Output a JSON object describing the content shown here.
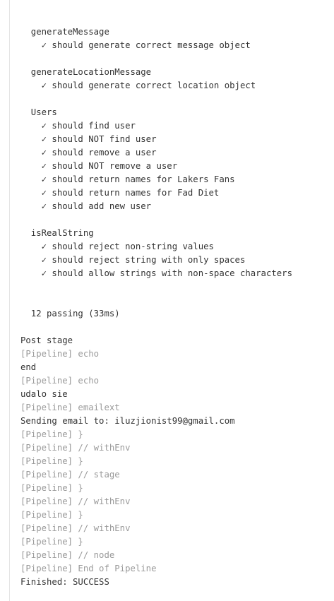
{
  "test_output": [
    {
      "kind": "blank",
      "text": ""
    },
    {
      "kind": "suite",
      "text": "  generateMessage"
    },
    {
      "kind": "test",
      "text": "    ✓ should generate correct message object"
    },
    {
      "kind": "blank",
      "text": ""
    },
    {
      "kind": "suite",
      "text": "  generateLocationMessage"
    },
    {
      "kind": "test",
      "text": "    ✓ should generate correct location object"
    },
    {
      "kind": "blank",
      "text": ""
    },
    {
      "kind": "suite",
      "text": "  Users"
    },
    {
      "kind": "test",
      "text": "    ✓ should find user"
    },
    {
      "kind": "test",
      "text": "    ✓ should NOT find user"
    },
    {
      "kind": "test",
      "text": "    ✓ should remove a user"
    },
    {
      "kind": "test",
      "text": "    ✓ should NOT remove a user"
    },
    {
      "kind": "test",
      "text": "    ✓ should return names for Lakers Fans"
    },
    {
      "kind": "test",
      "text": "    ✓ should return names for Fad Diet"
    },
    {
      "kind": "test",
      "text": "    ✓ should add new user"
    },
    {
      "kind": "blank",
      "text": ""
    },
    {
      "kind": "suite",
      "text": "  isRealString"
    },
    {
      "kind": "test",
      "text": "    ✓ should reject non-string values"
    },
    {
      "kind": "test",
      "text": "    ✓ should reject string with only spaces"
    },
    {
      "kind": "test",
      "text": "    ✓ should allow strings with non-space characters"
    },
    {
      "kind": "blank",
      "text": ""
    },
    {
      "kind": "blank",
      "text": ""
    },
    {
      "kind": "summary",
      "text": "  12 passing (33ms)"
    },
    {
      "kind": "blank",
      "text": ""
    }
  ],
  "pipeline_output": [
    {
      "kind": "normal",
      "text": "Post stage"
    },
    {
      "kind": "pipeline",
      "text": "[Pipeline] echo"
    },
    {
      "kind": "normal",
      "text": "end"
    },
    {
      "kind": "pipeline",
      "text": "[Pipeline] echo"
    },
    {
      "kind": "normal",
      "text": "udalo sie"
    },
    {
      "kind": "pipeline",
      "text": "[Pipeline] emailext"
    },
    {
      "kind": "normal",
      "text": "Sending email to: iluzjionist99@gmail.com"
    },
    {
      "kind": "pipeline",
      "text": "[Pipeline] }"
    },
    {
      "kind": "pipeline",
      "text": "[Pipeline] // withEnv"
    },
    {
      "kind": "pipeline",
      "text": "[Pipeline] }"
    },
    {
      "kind": "pipeline",
      "text": "[Pipeline] // stage"
    },
    {
      "kind": "pipeline",
      "text": "[Pipeline] }"
    },
    {
      "kind": "pipeline",
      "text": "[Pipeline] // withEnv"
    },
    {
      "kind": "pipeline",
      "text": "[Pipeline] }"
    },
    {
      "kind": "pipeline",
      "text": "[Pipeline] // withEnv"
    },
    {
      "kind": "pipeline",
      "text": "[Pipeline] }"
    },
    {
      "kind": "pipeline",
      "text": "[Pipeline] // node"
    },
    {
      "kind": "pipeline",
      "text": "[Pipeline] End of Pipeline"
    },
    {
      "kind": "normal",
      "text": "Finished: SUCCESS"
    }
  ],
  "colors": {
    "text": "#333333",
    "pipeline_marker": "#9a9a9a",
    "rule": "#e4e4e4"
  }
}
